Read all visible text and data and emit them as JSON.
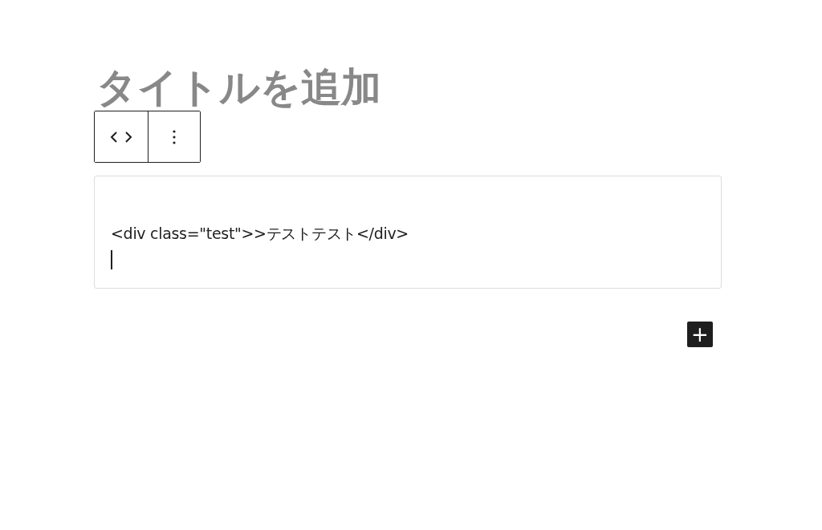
{
  "title": {
    "placeholder": "タイトルを追加"
  },
  "block_toolbar": {
    "buttons": [
      {
        "kind": "code"
      },
      {
        "kind": "more"
      }
    ]
  },
  "html_block": {
    "value": "<div class=\"test\">>テストテスト</div>",
    "cursor": true
  },
  "add_block_button": {
    "label": "+"
  }
}
